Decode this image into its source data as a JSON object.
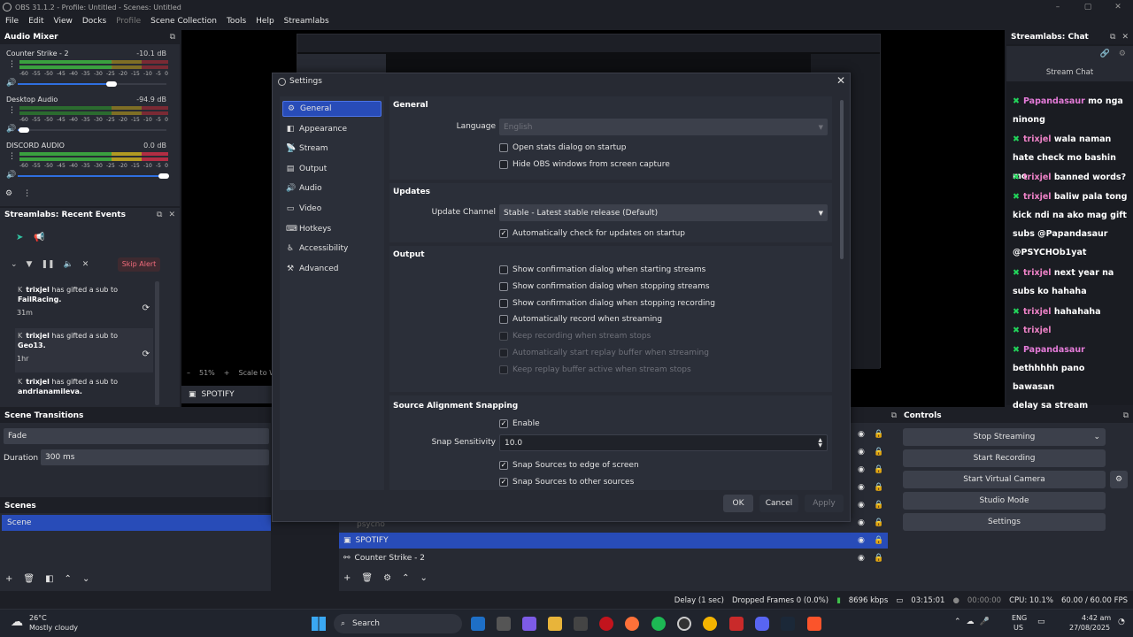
{
  "titlebar": {
    "title": "OBS 31.1.2 - Profile: Untitled - Scenes: Untitled"
  },
  "menu": [
    "File",
    "Edit",
    "View",
    "Docks",
    "Profile",
    "Scene Collection",
    "Tools",
    "Help",
    "Streamlabs"
  ],
  "mixer": {
    "title": "Audio Mixer",
    "ticks": [
      "-60",
      "-55",
      "-50",
      "-45",
      "-40",
      "-35",
      "-30",
      "-25",
      "-20",
      "-15",
      "-10",
      "-5",
      "0"
    ],
    "channels": [
      {
        "name": "Counter Strike - 2",
        "db": "-10.1 dB",
        "level": 0.62,
        "volume": 0.63
      },
      {
        "name": "Desktop Audio",
        "db": "-94.9 dB",
        "level": 0.0,
        "volume": 0.04
      },
      {
        "name": "DISCORD AUDIO",
        "db": "0.0 dB",
        "level": 1.0,
        "volume": 0.98
      }
    ]
  },
  "events": {
    "title": "Streamlabs: Recent Events",
    "skip_alert": "Skip Alert",
    "items": [
      {
        "user": "trixjel",
        "text": "has gifted a sub to",
        "target": "FailRacing.",
        "time": "31m"
      },
      {
        "user": "trixjel",
        "text": "has gifted a sub to",
        "target": "Geo13.",
        "time": "1hr"
      },
      {
        "user": "trixjel",
        "text": "has gifted a sub to",
        "target": "andrianamileva.",
        "time": ""
      }
    ]
  },
  "preview": {
    "zoom": "51%",
    "scale_label": "Scale to W",
    "source_name": "SPOTIFY"
  },
  "transitions": {
    "title": "Scene Transitions",
    "selected": "Fade",
    "duration_label": "Duration",
    "duration": "300 ms"
  },
  "scenes": {
    "title": "Scenes",
    "items": [
      "Scene"
    ]
  },
  "sources": {
    "items": [
      "psycho",
      "SPOTIFY",
      "Counter Strike - 2"
    ]
  },
  "controls": {
    "title": "Controls",
    "buttons": [
      "Stop Streaming",
      "Start Recording",
      "Start Virtual Camera",
      "Studio Mode",
      "Settings"
    ]
  },
  "chat": {
    "title": "Streamlabs: Chat",
    "subtitle": "Stream Chat",
    "messages": [
      {
        "user": "Papandasaur",
        "lines": [
          "mo nga",
          "ninong"
        ]
      },
      {
        "user": "trixjel",
        "lines": [
          "wala naman",
          "hate check mo bashin mo"
        ]
      },
      {
        "user": "trixjel",
        "lines": [
          "banned words?"
        ]
      },
      {
        "user": "trixjel",
        "lines": [
          "baliw pala tong",
          "kick ndi na ako mag gift",
          "subs @Papandasaur",
          "@PSYCHOb1yat"
        ]
      },
      {
        "user": "trixjel",
        "lines": [
          "next year na",
          "subs ko hahaha"
        ]
      },
      {
        "user": "trixjel",
        "lines": [
          "hahahaha"
        ]
      },
      {
        "user": "trixjel",
        "lines": [
          ""
        ]
      },
      {
        "user": "Papandasaur",
        "lines": [
          "",
          "bethhhhh pano bawasan",
          "delay sa stream"
        ]
      }
    ]
  },
  "status": {
    "delay": "Delay (1 sec)",
    "dropped": "Dropped Frames 0 (0.0%)",
    "kbps": "8696 kbps",
    "stream_time": "03:15:01",
    "rec_time": "00:00:00",
    "cpu": "CPU: 10.1%",
    "fps": "60.00 / 60.00 FPS"
  },
  "taskbar": {
    "temp": "26°C",
    "weather": "Mostly cloudy",
    "search": "Search",
    "lang1": "ENG",
    "lang2": "US",
    "time": "4:42 am",
    "date": "27/08/2025"
  },
  "dialog": {
    "title": "Settings",
    "nav": [
      "General",
      "Appearance",
      "Stream",
      "Output",
      "Audio",
      "Video",
      "Hotkeys",
      "Accessibility",
      "Advanced"
    ],
    "nav_icons": [
      "gear-icon",
      "appearance-icon",
      "stream-icon",
      "output-icon",
      "audio-icon",
      "video-icon",
      "hotkeys-icon",
      "accessibility-icon",
      "advanced-icon"
    ],
    "general": {
      "title": "General",
      "language_label": "Language",
      "language": "English",
      "open_stats": "Open stats dialog on startup",
      "hide_obs": "Hide OBS windows from screen capture"
    },
    "updates": {
      "title": "Updates",
      "channel_label": "Update Channel",
      "channel": "Stable - Latest stable release (Default)",
      "auto_check": "Automatically check for updates on startup"
    },
    "output": {
      "title": "Output",
      "options": [
        {
          "label": "Show confirmation dialog when starting streams",
          "checked": false,
          "disabled": false
        },
        {
          "label": "Show confirmation dialog when stopping streams",
          "checked": false,
          "disabled": false
        },
        {
          "label": "Show confirmation dialog when stopping recording",
          "checked": false,
          "disabled": false
        },
        {
          "label": "Automatically record when streaming",
          "checked": false,
          "disabled": false
        },
        {
          "label": "Keep recording when stream stops",
          "checked": false,
          "disabled": true
        },
        {
          "label": "Automatically start replay buffer when streaming",
          "checked": false,
          "disabled": true
        },
        {
          "label": "Keep replay buffer active when stream stops",
          "checked": false,
          "disabled": true
        }
      ]
    },
    "snapping": {
      "title": "Source Alignment Snapping",
      "enable": "Enable",
      "sensitivity_label": "Snap Sensitivity",
      "sensitivity": "10.0",
      "edge": "Snap Sources to edge of screen",
      "other": "Snap Sources to other sources"
    },
    "buttons": {
      "ok": "OK",
      "cancel": "Cancel",
      "apply": "Apply"
    }
  },
  "colors": {
    "accent": "#284cb8",
    "green": "#22d35a",
    "chat_user": "#ee82c7"
  }
}
